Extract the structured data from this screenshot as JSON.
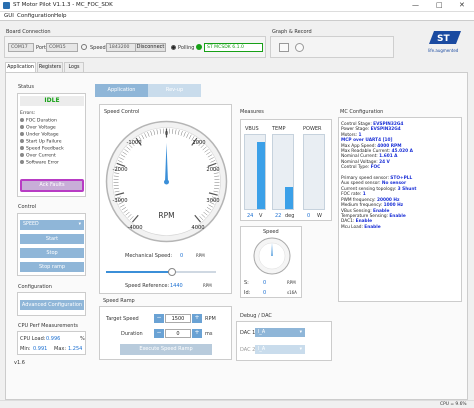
{
  "window": {
    "title": "ST Motor Pilot V1.1.3 - MC_FOC_SDK",
    "minimize": "—",
    "maximize": "□",
    "close": "✕"
  },
  "menu": [
    "GUI",
    "Configuration",
    "Help"
  ],
  "board_connection": {
    "title": "Board Connection",
    "com_port": "COM17",
    "port_label": "Port",
    "port_value": "COM15",
    "speed_label": "Speed",
    "speed_value": "1843200",
    "disconnect": "Disconnect",
    "polling": "Polling",
    "status": "ST MCSDK 6.1.0"
  },
  "graph_record": {
    "title": "Graph & Record"
  },
  "logo": {
    "text": "life.augmented"
  },
  "tabs": [
    "Application",
    "Registers",
    "Logs"
  ],
  "status": {
    "title": "Status",
    "state": "IDLE",
    "errors_label": "Errors:",
    "errors": [
      "FOC Duration",
      "Over Voltage",
      "Under Voltage",
      "Start Up Failure",
      "Speed Feedback",
      "Over Current",
      "Software Error"
    ],
    "ack": "Ack Faults"
  },
  "control": {
    "title": "Control",
    "mode": "SPEED",
    "start": "Start",
    "stop": "Stop",
    "stop_ramp": "Stop ramp"
  },
  "configuration": {
    "title": "Configuration",
    "advanced": "Advanced Configuration"
  },
  "cpu": {
    "title": "CPU Perf Measurements",
    "load_label": "CPU Load:",
    "load": "0.996",
    "load_unit": "%",
    "min_label": "Min:",
    "min": "0.991",
    "max_label": "Max:",
    "max": "1.254"
  },
  "version": "v1.6",
  "subtabs": [
    "Application",
    "Rev-up"
  ],
  "speed_control": {
    "title": "Speed Control",
    "gauge_labels": [
      "0",
      "-1000",
      "1000",
      "-2000",
      "2000",
      "-3000",
      "3000",
      "-4000",
      "4000"
    ],
    "rpm": "RPM",
    "needle_rpm": 0,
    "mech_label": "Mechanical Speed:",
    "mech_value": "0",
    "mech_unit": "RPM",
    "ref_label": "Speed Reference:",
    "ref_value": "1440",
    "ref_unit": "RPM",
    "slider_fraction": 0.6
  },
  "measures": {
    "title": "Measures",
    "meters": [
      {
        "name": "VBUS",
        "value": "24",
        "unit": "V",
        "level": 0.9
      },
      {
        "name": "TEMP",
        "value": "22",
        "unit": "deg",
        "level": 0.3
      },
      {
        "name": "POWER",
        "value": "0",
        "unit": "W",
        "level": 0.0
      }
    ]
  },
  "speed_mini": {
    "title": "Speed",
    "s_label": "S:",
    "s_value": "0",
    "s_unit": "RPM",
    "id_label": "Id:",
    "id_value": "0",
    "id_unit": "s16A"
  },
  "mc_config": {
    "title": "MC Configuration",
    "lines": [
      [
        "Control Stage: ",
        "EVSPIN32G4"
      ],
      [
        "Power Stage: ",
        "EVSPIN32G4"
      ],
      [
        "Motors: ",
        "1"
      ],
      [
        "MCP over UART4 [10]",
        ""
      ],
      [
        "Max App Speed: ",
        "4000 RPM"
      ],
      [
        "Max Readable Current: ",
        "45.020 A"
      ],
      [
        "Nominal Current: ",
        "1.601 A"
      ],
      [
        "Nominal Voltage: ",
        "24 V"
      ],
      [
        "Control Type: ",
        "FOC"
      ],
      [
        "",
        ""
      ],
      [
        "Primary speed sensor: ",
        "STO+PLL"
      ],
      [
        "Aux speed sensor: ",
        "No sensor"
      ],
      [
        "Current sensing topology: ",
        "3 Shunt"
      ],
      [
        "FOC rate: ",
        "1"
      ],
      [
        "PWM frequency: ",
        "20000 Hz"
      ],
      [
        "Medium frequency: ",
        "1000 Hz"
      ],
      [
        "VBus Sensing: ",
        "Enable"
      ],
      [
        "Temperature Sensing: ",
        "Enable"
      ],
      [
        "DAC1: ",
        "Enable"
      ],
      [
        "Mcu Load: ",
        "Enable"
      ]
    ]
  },
  "speed_ramp": {
    "title": "Speed Ramp",
    "target_label": "Target Speed",
    "target_value": "1500",
    "target_unit": "RPM",
    "duration_label": "Duration",
    "duration_value": "0",
    "duration_unit": "ms",
    "execute": "Execute Speed Ramp",
    "minus": "−",
    "plus": "+"
  },
  "debug_dac": {
    "title": "Debug / DAC",
    "dac1_label": "DAC 1",
    "dac1_value": "I_A",
    "dac2_label": "DAC 2",
    "dac2_value": "I_A"
  },
  "statusbar": {
    "cpu": "CPU = 9.6%"
  },
  "colors": {
    "accent": "#8fb6d8",
    "idle": "#18a318",
    "status_ok": "#17a017",
    "value_blue": "#1a2fd6"
  }
}
